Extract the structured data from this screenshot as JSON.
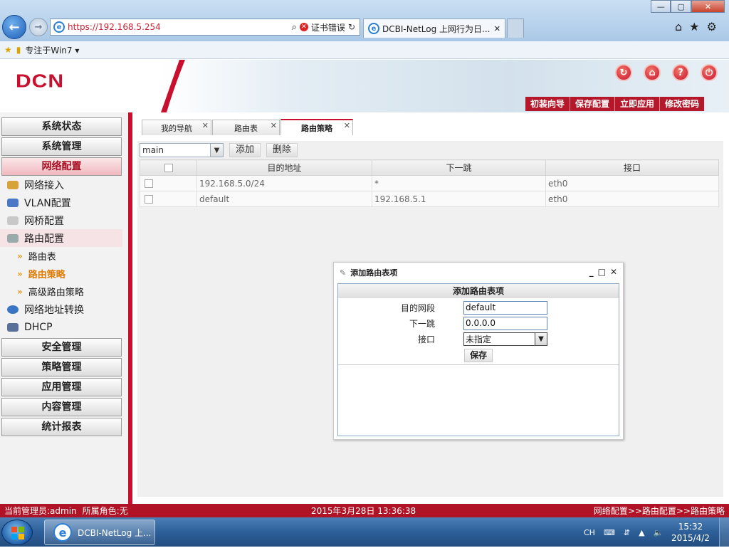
{
  "browser": {
    "address_url": "https://192.168.5.254",
    "cert_error": "证书错误",
    "tab_title": "DCBI-NetLog 上网行为日...",
    "tab_close": "✕",
    "favorites_label": "专注于Win7 ▾",
    "win_min": "—",
    "win_max": "▢",
    "win_close": "✕"
  },
  "header": {
    "logo": "DCN",
    "buttons": [
      "初装向导",
      "保存配置",
      "立即应用",
      "修改密码"
    ]
  },
  "sidebar": {
    "main_items_top": [
      "系统状态",
      "系统管理",
      "网络配置"
    ],
    "sub_items": [
      "网络接入",
      "VLAN配置",
      "网桥配置",
      "路由配置"
    ],
    "leaf_items": [
      "路由表",
      "路由策略",
      "高级路由策略"
    ],
    "sub_items_after": [
      "网络地址转换",
      "DHCP"
    ],
    "main_items_bottom": [
      "安全管理",
      "策略管理",
      "应用管理",
      "内容管理",
      "统计报表"
    ]
  },
  "content": {
    "tabs": [
      "我的导航",
      "路由表",
      "路由策略"
    ],
    "tab_close": "✕",
    "select_value": "main",
    "btn_add": "添加",
    "btn_delete": "删除",
    "columns": [
      "目的地址",
      "下一跳",
      "接口"
    ],
    "rows": [
      [
        "192.168.5.0/24",
        "*",
        "eth0"
      ],
      [
        "default",
        "192.168.5.1",
        "eth0"
      ]
    ]
  },
  "dialog": {
    "title": "添加路由表项",
    "heading": "添加路由表项",
    "label_dest": "目的网段",
    "value_dest": "default",
    "label_next": "下一跳",
    "value_next": "0.0.0.0",
    "label_iface": "接口",
    "value_iface": "未指定",
    "save": "保存",
    "ctrl_min": "_",
    "ctrl_max": "□",
    "ctrl_close": "✕"
  },
  "status": {
    "admin": "当前管理员:admin",
    "role": "所属角色:无",
    "datetime": "2015年3月28日 13:36:38",
    "breadcrumb": "网络配置>>路由配置>>路由策略"
  },
  "taskbar": {
    "task_title": "DCBI-NetLog 上...",
    "lang": "CH",
    "time": "15:32",
    "date": "2015/4/2"
  },
  "colors": {
    "brand_red": "#c8102e",
    "status_red": "#b01326"
  }
}
